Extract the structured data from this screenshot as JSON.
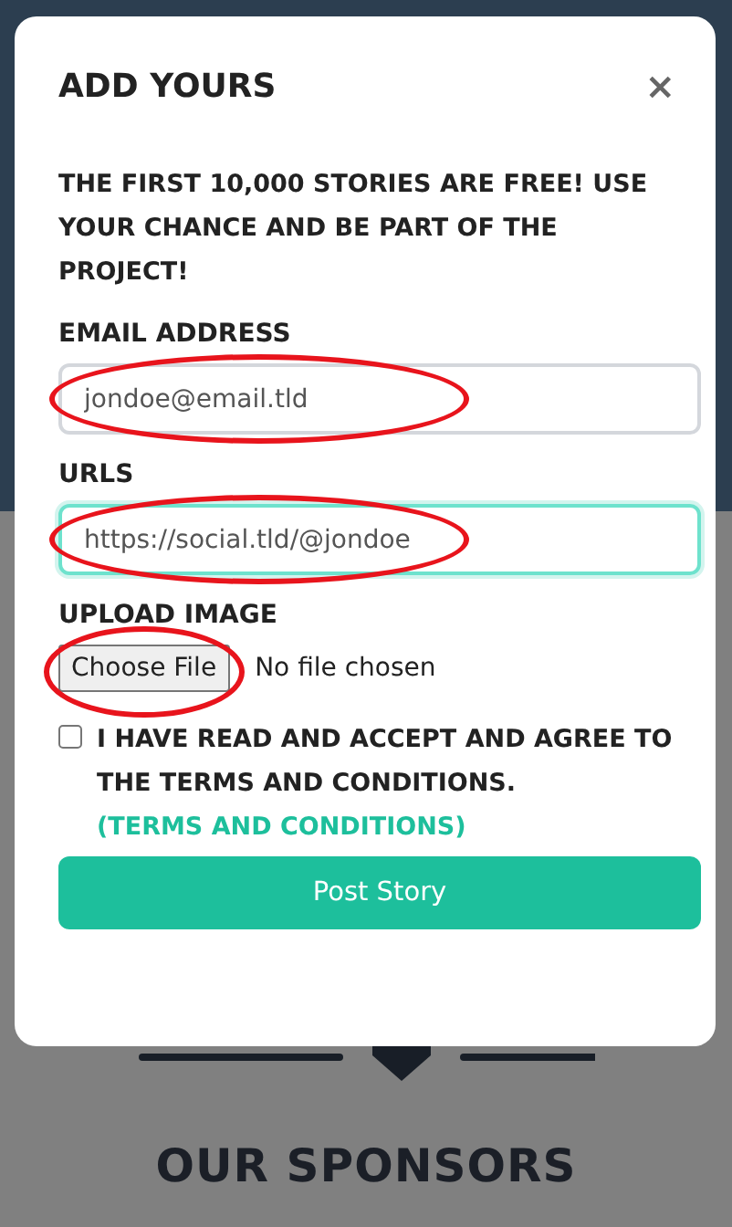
{
  "modal": {
    "title": "ADD YOURS",
    "close": "×",
    "intro": "THE FIRST 10,000 STORIES ARE FREE! USE YOUR CHANCE AND BE PART OF THE PROJECT!",
    "fields": [
      {
        "kind": "text",
        "label": "EMAIL ADDRESS",
        "value": "jondoe@email.tld",
        "focused": false,
        "circled": true
      },
      {
        "kind": "text",
        "label": "URLS",
        "value": "https://social.tld/@jondoe",
        "focused": true,
        "circled": true
      },
      {
        "kind": "file",
        "label": "UPLOAD IMAGE",
        "button": "Choose File",
        "status": "No file chosen",
        "circled": true
      }
    ],
    "consent": {
      "checked": false,
      "text": "I HAVE READ AND ACCEPT AND AGREE TO THE TERMS AND CONDITIONS.",
      "link": "(TERMS AND CONDITIONS)"
    },
    "submit": "Post Story"
  },
  "page": {
    "heading": "OUR SPONSORS"
  }
}
